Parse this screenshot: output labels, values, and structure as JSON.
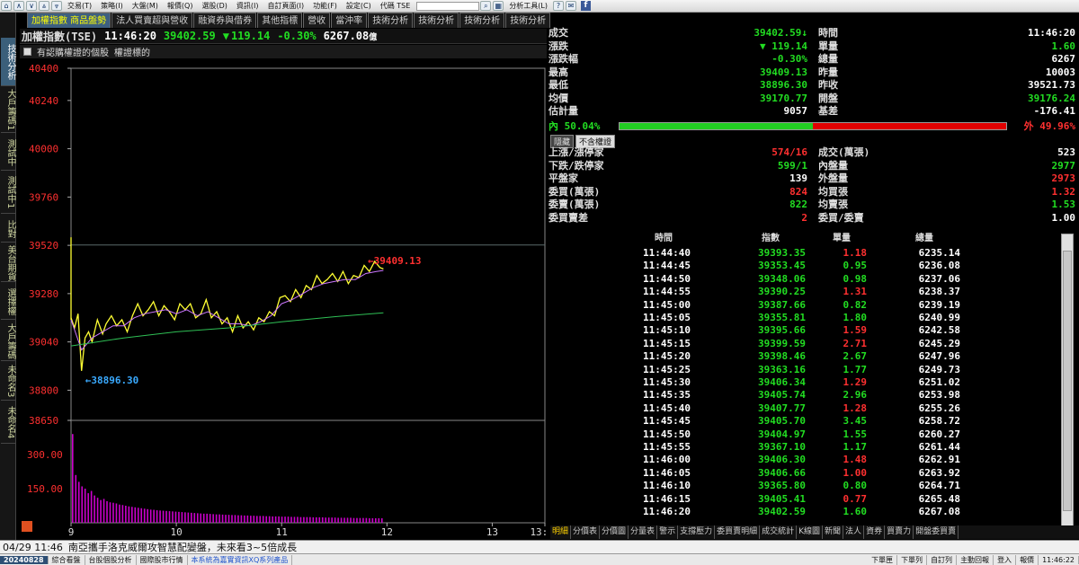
{
  "menubar": {
    "nav_icons": [
      "home-icon",
      "up-icon",
      "down-icon",
      "double-up-icon",
      "double-down-icon"
    ],
    "items": [
      "交易(T)",
      "策略(I)",
      "大盤(M)",
      "報價(Q)",
      "選股(D)",
      "資訊(I)",
      "自訂頁面(I)",
      "功能(F)",
      "設定(C)",
      "代碼 TSE"
    ],
    "right_label": "分析工具(L)"
  },
  "side_tabs": [
    "技術分析",
    "大戶籌碼1",
    "測試中",
    "測試中1",
    "比對",
    "美台期貨",
    "選擇權",
    "大戶籌碼",
    "未命名3",
    "未命名4"
  ],
  "top_tabs": [
    "加權指數 商品盤勢",
    "法人買賣超與營收",
    "融資券與借券",
    "其他指標",
    "營收",
    "當沖率",
    "技術分析",
    "技術分析",
    "技術分析",
    "技術分析"
  ],
  "quote": {
    "name": "加權指數(TSE)",
    "time": "11:46:20",
    "price": "39402.59",
    "arrow": "▼",
    "change": "119.14",
    "pct": "-0.30%",
    "volume": "6267.08",
    "unit": "億"
  },
  "filter": {
    "label1": "有認購權證的個股",
    "label2": "權證標的"
  },
  "chart_data": [
    {
      "type": "line",
      "panel": "price",
      "ylim": [
        38650,
        40400
      ],
      "yticks": [
        "40400",
        "40240",
        "40000",
        "39760",
        "39520",
        "39280",
        "39040",
        "38800",
        "38650"
      ],
      "ytick_values": [
        40400,
        40240,
        40000,
        39760,
        39520,
        39280,
        39040,
        38800,
        38650
      ],
      "xticks": [
        "9",
        "10",
        "11",
        "12",
        "13",
        "13:30"
      ],
      "xtick_minutes": [
        0,
        60,
        120,
        180,
        240,
        270
      ],
      "reference_line": 39521.73,
      "annotations": [
        {
          "text": "←39409.13",
          "value": 39409.13,
          "color": "#ff3030"
        },
        {
          "text": "←38896.30",
          "value": 38896.3,
          "color": "#3aaaff"
        }
      ],
      "series": [
        {
          "color": "#ffff33",
          "points": [
            [
              0,
              39160
            ],
            [
              2,
              39110
            ],
            [
              4,
              39180
            ],
            [
              6,
              38896.3
            ],
            [
              8,
              39060
            ],
            [
              10,
              39090
            ],
            [
              12,
              39040
            ],
            [
              15,
              39150
            ],
            [
              18,
              39080
            ],
            [
              20,
              39130
            ],
            [
              23,
              39170
            ],
            [
              26,
              39120
            ],
            [
              29,
              39150
            ],
            [
              32,
              39090
            ],
            [
              35,
              39170
            ],
            [
              38,
              39230
            ],
            [
              41,
              39170
            ],
            [
              44,
              39200
            ],
            [
              47,
              39240
            ],
            [
              50,
              39170
            ],
            [
              53,
              39220
            ],
            [
              56,
              39190
            ],
            [
              59,
              39150
            ],
            [
              62,
              39230
            ],
            [
              65,
              39200
            ],
            [
              68,
              39230
            ],
            [
              71,
              39160
            ],
            [
              74,
              39180
            ],
            [
              77,
              39250
            ],
            [
              80,
              39160
            ],
            [
              83,
              39190
            ],
            [
              86,
              39130
            ],
            [
              89,
              39160
            ],
            [
              92,
              39090
            ],
            [
              95,
              39170
            ],
            [
              98,
              39110
            ],
            [
              101,
              39140
            ],
            [
              104,
              39100
            ],
            [
              107,
              39160
            ],
            [
              110,
              39140
            ],
            [
              113,
              39190
            ],
            [
              116,
              39170
            ],
            [
              119,
              39260
            ],
            [
              122,
              39270
            ],
            [
              125,
              39240
            ],
            [
              128,
              39300
            ],
            [
              131,
              39260
            ],
            [
              134,
              39320
            ],
            [
              137,
              39300
            ],
            [
              140,
              39370
            ],
            [
              143,
              39330
            ],
            [
              146,
              39350
            ],
            [
              149,
              39380
            ],
            [
              152,
              39340
            ],
            [
              155,
              39390
            ],
            [
              158,
              39330
            ],
            [
              161,
              39370
            ],
            [
              164,
              39360
            ],
            [
              167,
              39420
            ],
            [
              170,
              39390
            ],
            [
              173,
              39440
            ],
            [
              176,
              39410
            ],
            [
              178,
              39402.59
            ]
          ]
        },
        {
          "color": "#cc77ff",
          "points": [
            [
              0,
              39150
            ],
            [
              6,
              39000
            ],
            [
              12,
              39060
            ],
            [
              18,
              39090
            ],
            [
              24,
              39120
            ],
            [
              30,
              39120
            ],
            [
              36,
              39160
            ],
            [
              42,
              39180
            ],
            [
              48,
              39190
            ],
            [
              54,
              39200
            ],
            [
              60,
              39180
            ],
            [
              66,
              39200
            ],
            [
              72,
              39170
            ],
            [
              78,
              39190
            ],
            [
              84,
              39160
            ],
            [
              90,
              39130
            ],
            [
              96,
              39130
            ],
            [
              102,
              39120
            ],
            [
              108,
              39140
            ],
            [
              114,
              39170
            ],
            [
              120,
              39230
            ],
            [
              126,
              39250
            ],
            [
              132,
              39280
            ],
            [
              138,
              39310
            ],
            [
              144,
              39330
            ],
            [
              150,
              39340
            ],
            [
              156,
              39350
            ],
            [
              162,
              39350
            ],
            [
              168,
              39380
            ],
            [
              174,
              39390
            ],
            [
              178,
              39395
            ]
          ]
        },
        {
          "color": "#2fbf55",
          "points": [
            [
              0,
              39020
            ],
            [
              30,
              39060
            ],
            [
              60,
              39090
            ],
            [
              90,
              39110
            ],
            [
              120,
              39140
            ],
            [
              150,
              39165
            ],
            [
              178,
              39185
            ]
          ]
        }
      ]
    },
    {
      "type": "bar",
      "panel": "volume",
      "ylim": [
        0,
        450
      ],
      "yticks": [
        "300.00",
        "150.00"
      ],
      "ytick_values": [
        300,
        150
      ],
      "color": "#cc00cc",
      "values": [
        390,
        210,
        180,
        160,
        150,
        130,
        140,
        120,
        110,
        100,
        105,
        95,
        90,
        88,
        85,
        80,
        78,
        75,
        72,
        70,
        68,
        66,
        64,
        62,
        60,
        58,
        57,
        55,
        54,
        53,
        52,
        51,
        50,
        49,
        48,
        47,
        46,
        45,
        44,
        43,
        42,
        41,
        40,
        40,
        39,
        38,
        37,
        37,
        36,
        35,
        35,
        34,
        34,
        33,
        33,
        32,
        32,
        31,
        31,
        30,
        30,
        30,
        29,
        29,
        28,
        28,
        28,
        27,
        27,
        27,
        26,
        26,
        26,
        25,
        25,
        25,
        25,
        24,
        24,
        24,
        24,
        23,
        23,
        23,
        23,
        22,
        22,
        22,
        22,
        22,
        21,
        21,
        21,
        21,
        21,
        20,
        20,
        20,
        20,
        20
      ]
    }
  ],
  "summary": {
    "left": [
      {
        "label": "成交",
        "value": "39402.59↓",
        "color": "#22dd22"
      },
      {
        "label": "漲跌",
        "value": "▼ 119.14",
        "color": "#22dd22"
      },
      {
        "label": "漲跌幅",
        "value": "-0.30%",
        "color": "#22dd22"
      },
      {
        "label": "最高",
        "value": "39409.13",
        "color": "#22dd22"
      },
      {
        "label": "最低",
        "value": "38896.30",
        "color": "#22dd22"
      },
      {
        "label": "均價",
        "value": "39170.77",
        "color": "#22dd22"
      },
      {
        "label": "估計量",
        "value": "9057",
        "color": "#ffffff"
      }
    ],
    "right": [
      {
        "label": "時間",
        "value": "11:46:20",
        "color": "#ffffff"
      },
      {
        "label": "單量",
        "value": "1.60",
        "color": "#22dd22"
      },
      {
        "label": "總量",
        "value": "6267",
        "color": "#ffffff"
      },
      {
        "label": "昨量",
        "value": "10003",
        "color": "#ffffff"
      },
      {
        "label": "昨收",
        "value": "39521.73",
        "color": "#ffffff"
      },
      {
        "label": "開盤",
        "value": "39176.24",
        "color": "#22dd22"
      },
      {
        "label": "基差",
        "value": "-176.41",
        "color": "#ffffff"
      }
    ]
  },
  "inout": {
    "in_label": "內 50.04%",
    "out_label": "外 49.96%",
    "in_fraction": 0.5004
  },
  "buttons": {
    "b1": "隱藏",
    "b2": "不含權證"
  },
  "breadth": {
    "left": [
      {
        "label": "上漲/漲停家",
        "value": "574/16",
        "color": "#ff3030"
      },
      {
        "label": "下跌/跌停家",
        "value": "599/1",
        "color": "#22dd22"
      },
      {
        "label": "平盤家",
        "value": "139",
        "color": "#ffffff"
      },
      {
        "label": "委買(萬張)",
        "value": "824",
        "color": "#ff3030"
      },
      {
        "label": "委賣(萬張)",
        "value": "822",
        "color": "#22dd22"
      },
      {
        "label": "委買賣差",
        "value": "2",
        "color": "#ff3030"
      }
    ],
    "right": [
      {
        "label": "成交(萬張)",
        "value": "523",
        "color": "#ffffff"
      },
      {
        "label": "內盤量",
        "value": "2977",
        "color": "#22dd22"
      },
      {
        "label": "外盤量",
        "value": "2973",
        "color": "#ff3030"
      },
      {
        "label": "均買張",
        "value": "1.32",
        "color": "#ff3030"
      },
      {
        "label": "均賣張",
        "value": "1.53",
        "color": "#22dd22"
      },
      {
        "label": "委買/委賣",
        "value": "1.00",
        "color": "#ffffff"
      }
    ]
  },
  "ticks": {
    "headers": [
      "時間",
      "指數",
      "單量",
      "總量"
    ],
    "rows": [
      [
        "11:44:40",
        "39393.35",
        "1.18",
        "6235.14",
        "r"
      ],
      [
        "11:44:45",
        "39353.45",
        "0.95",
        "6236.08",
        "g"
      ],
      [
        "11:44:50",
        "39348.06",
        "0.98",
        "6237.06",
        "g"
      ],
      [
        "11:44:55",
        "39390.25",
        "1.31",
        "6238.37",
        "r"
      ],
      [
        "11:45:00",
        "39387.66",
        "0.82",
        "6239.19",
        "g"
      ],
      [
        "11:45:05",
        "39355.81",
        "1.80",
        "6240.99",
        "g"
      ],
      [
        "11:45:10",
        "39395.66",
        "1.59",
        "6242.58",
        "r"
      ],
      [
        "11:45:15",
        "39399.59",
        "2.71",
        "6245.29",
        "r"
      ],
      [
        "11:45:20",
        "39398.46",
        "2.67",
        "6247.96",
        "g"
      ],
      [
        "11:45:25",
        "39363.16",
        "1.77",
        "6249.73",
        "g"
      ],
      [
        "11:45:30",
        "39406.34",
        "1.29",
        "6251.02",
        "r"
      ],
      [
        "11:45:35",
        "39405.74",
        "2.96",
        "6253.98",
        "g"
      ],
      [
        "11:45:40",
        "39407.77",
        "1.28",
        "6255.26",
        "r"
      ],
      [
        "11:45:45",
        "39405.70",
        "3.45",
        "6258.72",
        "g"
      ],
      [
        "11:45:50",
        "39404.97",
        "1.55",
        "6260.27",
        "g"
      ],
      [
        "11:45:55",
        "39367.10",
        "1.17",
        "6261.44",
        "g"
      ],
      [
        "11:46:00",
        "39406.30",
        "1.48",
        "6262.91",
        "r"
      ],
      [
        "11:46:05",
        "39406.66",
        "1.00",
        "6263.92",
        "r"
      ],
      [
        "11:46:10",
        "39365.80",
        "0.80",
        "6264.71",
        "g"
      ],
      [
        "11:46:15",
        "39405.41",
        "0.77",
        "6265.48",
        "r"
      ],
      [
        "11:46:20",
        "39402.59",
        "1.60",
        "6267.08",
        "g"
      ]
    ]
  },
  "bottom_tabs": [
    "明細",
    "分價表",
    "分價圖",
    "分量表",
    "警示",
    "支撐壓力",
    "委買賣明細",
    "成交統計",
    "K線圖",
    "新聞",
    "法人",
    "資券",
    "買賣力",
    "開盤委買賣"
  ],
  "ticker": {
    "time": "04/29 11:46",
    "text": "南亞攜手洛克威爾攻智慧配變盤，未來看3~5倍成長"
  },
  "status": {
    "date": "20240828",
    "items": [
      "綜合看盤",
      "台股個股分析",
      "國際股市行情"
    ],
    "notice": "本系統為嘉實資訊XQ系列產品",
    "right": [
      "下單匣",
      "下單列",
      "自訂列",
      "主動回報",
      "登入",
      "報價",
      "11:46:22"
    ]
  },
  "colors": {
    "up": "#ff3030",
    "down": "#22dd22",
    "accent": "#ffff33"
  }
}
